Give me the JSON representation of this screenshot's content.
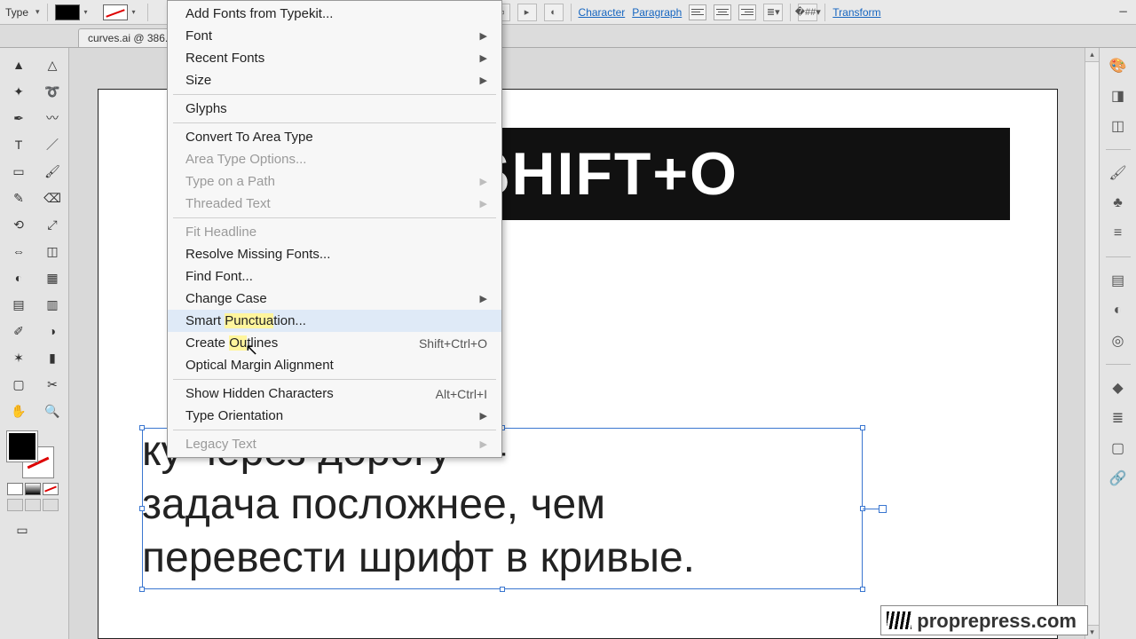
{
  "topbar": {
    "mode_label": "Type",
    "character_link": "Character",
    "paragraph_link": "Paragraph",
    "transform_link": "Transform"
  },
  "doc_tab": {
    "title": "curves.ai @ 386..."
  },
  "menu": {
    "items": [
      {
        "label": "Add Fonts from Typekit...",
        "submenu": false,
        "disabled": false
      },
      {
        "label": "Font",
        "submenu": true,
        "disabled": false
      },
      {
        "label": "Recent Fonts",
        "submenu": true,
        "disabled": false
      },
      {
        "label": "Size",
        "submenu": true,
        "disabled": false
      },
      "---",
      {
        "label": "Glyphs",
        "submenu": false,
        "disabled": false
      },
      "---",
      {
        "label": "Convert To Area Type",
        "submenu": false,
        "disabled": false
      },
      {
        "label": "Area Type Options...",
        "submenu": false,
        "disabled": true
      },
      {
        "label": "Type on a Path",
        "submenu": true,
        "disabled": true
      },
      {
        "label": "Threaded Text",
        "submenu": true,
        "disabled": true
      },
      "---",
      {
        "label": "Fit Headline",
        "submenu": false,
        "disabled": true
      },
      {
        "label": "Resolve Missing Fonts...",
        "submenu": false,
        "disabled": false
      },
      {
        "label": "Find Font...",
        "submenu": false,
        "disabled": false
      },
      {
        "label": "Change Case",
        "submenu": true,
        "disabled": false
      },
      {
        "label": "Smart Punctuation...",
        "submenu": false,
        "disabled": false,
        "hover": true
      },
      {
        "label": "Create Outlines",
        "submenu": false,
        "disabled": false,
        "shortcut": "Shift+Ctrl+O"
      },
      {
        "label": "Optical Margin Alignment",
        "submenu": false,
        "disabled": false
      },
      "---",
      {
        "label": "Show Hidden Characters",
        "submenu": false,
        "disabled": false,
        "shortcut": "Alt+Ctrl+I"
      },
      {
        "label": "Type Orientation",
        "submenu": true,
        "disabled": false
      },
      "---",
      {
        "label": "Legacy Text",
        "submenu": true,
        "disabled": true
      }
    ]
  },
  "canvas": {
    "banner_text": "CTRL+SHIFT+O",
    "body_text": "ку через дорогу —\nзадача посложнее, чем\nперевести шрифт в кривые."
  },
  "watermark": "proprepress.com",
  "tools_left": [
    "selection",
    "direct-selection",
    "magic-wand",
    "lasso",
    "pen",
    "curvature",
    "type",
    "line",
    "rectangle",
    "paintbrush",
    "pencil",
    "eraser",
    "rotate",
    "scale",
    "width",
    "free-transform",
    "shape-builder",
    "perspective",
    "mesh",
    "gradient",
    "eyedropper",
    "blend",
    "symbol-sprayer",
    "column-graph",
    "artboard",
    "slice",
    "hand",
    "zoom"
  ],
  "dock_right": [
    "color",
    "color-guide",
    "swatches",
    "brushes",
    "symbols",
    "stroke",
    "gradient-panel",
    "transparency",
    "appearance",
    "graphic-styles",
    "layers",
    "artboards",
    "links"
  ]
}
